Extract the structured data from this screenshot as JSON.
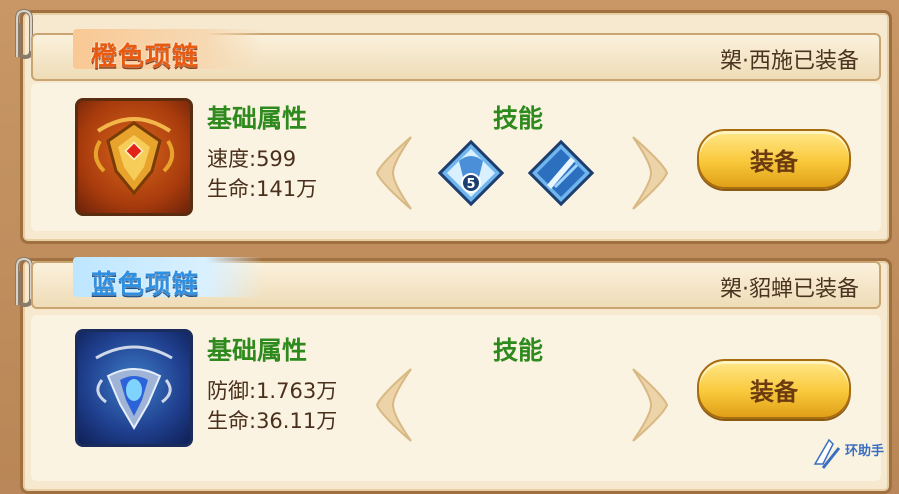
{
  "cards": [
    {
      "title": "橙色项链",
      "equipped": "槊·西施已装备",
      "attr_label": "基础属性",
      "skill_label": "技能",
      "stats": [
        "速度:599",
        "生命:141万"
      ],
      "button": "装备",
      "skill_badge": "5",
      "colors": {
        "title": "#e75a10",
        "accent": "#2f8a1d"
      },
      "icons": [
        "orange-necklace-icon",
        "skill-wolf-icon",
        "skill-blade-icon"
      ]
    },
    {
      "title": "蓝色项链",
      "equipped": "槊·貂蝉已装备",
      "attr_label": "基础属性",
      "skill_label": "技能",
      "stats": [
        "防御:1.763万",
        "生命:36.11万"
      ],
      "button": "装备",
      "colors": {
        "title": "#2f8fe0",
        "accent": "#2f8a1d"
      },
      "icons": [
        "blue-necklace-icon"
      ]
    }
  ],
  "watermark": "环助手"
}
